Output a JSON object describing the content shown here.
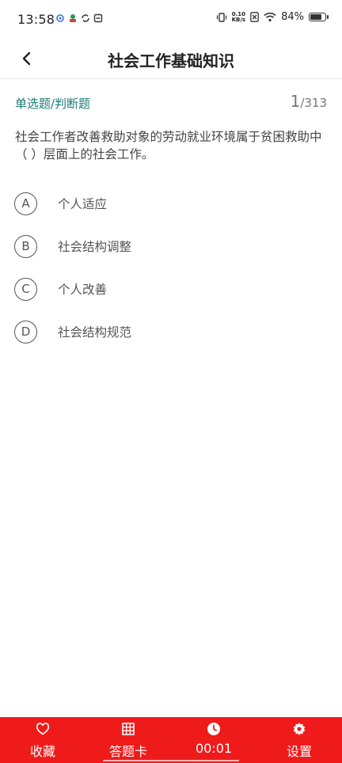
{
  "status_bar": {
    "time": "13:58",
    "net_speed_value": "0.10",
    "net_speed_unit": "KB/s",
    "battery_percent": "84%",
    "battery_level": 0.84
  },
  "nav": {
    "title": "社会工作基础知识"
  },
  "question": {
    "type_label": "单选题/判断题",
    "current": "1",
    "total": "/313",
    "text": "社会工作者改善救助对象的劳动就业环境属于贫困救助中（ ）层面上的社会工作。"
  },
  "options": [
    {
      "letter": "A",
      "text": "个人适应"
    },
    {
      "letter": "B",
      "text": "社会结构调整"
    },
    {
      "letter": "C",
      "text": "个人改善"
    },
    {
      "letter": "D",
      "text": "社会结构规范"
    }
  ],
  "tabbar": {
    "favorite": "收藏",
    "answer_card": "答题卡",
    "timer": "00:01",
    "settings": "设置"
  },
  "colors": {
    "accent_red": "#ef1b1b",
    "type_teal": "#1c7a76"
  }
}
